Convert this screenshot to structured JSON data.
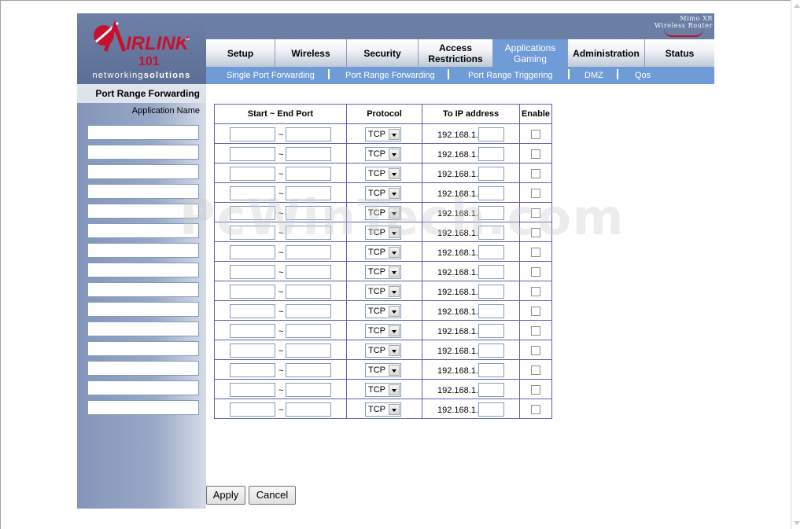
{
  "brand": {
    "logo_text": "AIRLINK",
    "logo_number": "101",
    "tagline_light": "networking",
    "tagline_bold": "solutions",
    "product_line1": "Mimo XR",
    "product_line2": "Wireless Router"
  },
  "tabs": [
    {
      "label": "Setup"
    },
    {
      "label": "Wireless"
    },
    {
      "label": "Security"
    },
    {
      "label": "Access Restrictions"
    },
    {
      "label": "Applications Gaming"
    },
    {
      "label": "Administration"
    },
    {
      "label": "Status"
    }
  ],
  "active_tab": "Applications Gaming",
  "subnav": [
    {
      "label": "Single Port Forwarding"
    },
    {
      "label": "Port Range Forwarding"
    },
    {
      "label": "Port Range Triggering"
    },
    {
      "label": "DMZ"
    },
    {
      "label": "Qos"
    }
  ],
  "sidebar": {
    "section_title": "Port Range Forwarding",
    "column_label": "Application Name"
  },
  "table": {
    "headers": [
      "Start ~ End Port",
      "Protocol",
      "To IP address",
      "Enable"
    ],
    "range_separator": "~",
    "protocol_value": "TCP",
    "ip_prefix": "192.168.1.",
    "row_count": 15
  },
  "buttons": {
    "apply": "Apply",
    "cancel": "Cancel"
  },
  "watermark": "PcWinTech.com",
  "colors": {
    "header_bg": "#6b7ea4",
    "active_tab": "#6f9bd6",
    "table_border": "#5f5fb0"
  }
}
